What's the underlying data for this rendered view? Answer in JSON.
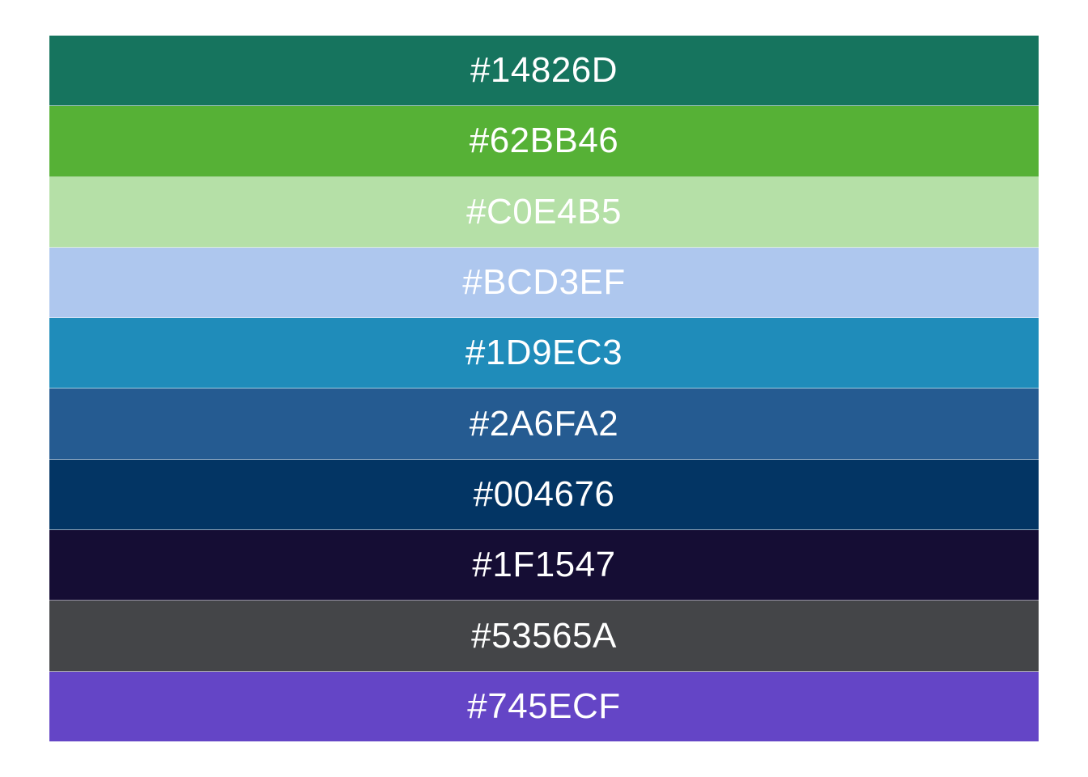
{
  "swatches": [
    {
      "label": "#14826D",
      "fill": "#16745e"
    },
    {
      "label": "#62BB46",
      "fill": "#56b136"
    },
    {
      "label": "#C0E4B5",
      "fill": "#b5e0a7"
    },
    {
      "label": "#BCD3EF",
      "fill": "#aec7ee"
    },
    {
      "label": "#1D9EC3",
      "fill": "#1f8cba"
    },
    {
      "label": "#2A6FA2",
      "fill": "#255b91"
    },
    {
      "label": "#004676",
      "fill": "#033564"
    },
    {
      "label": "#1F1547",
      "fill": "#150d34"
    },
    {
      "label": "#53565A",
      "fill": "#444548"
    },
    {
      "label": "#745ECF",
      "fill": "#6445c6"
    }
  ]
}
